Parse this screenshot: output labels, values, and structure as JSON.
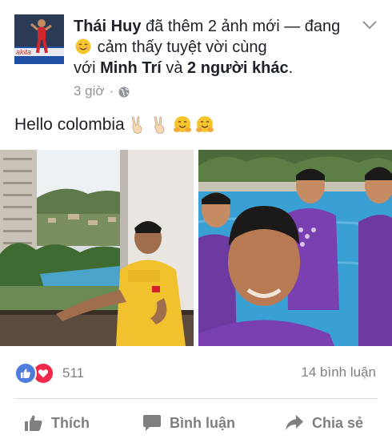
{
  "post": {
    "author": "Thái Huy",
    "action_text": "đã thêm 2 ảnh mới —",
    "feeling_prefix": "đang",
    "feeling_text": "cảm thấy tuyệt vời cùng",
    "with_prefix": "với",
    "tagged_person": "Minh Trí",
    "and_text": "và",
    "others_text": "2 người khác",
    "period": ".",
    "time": "3 giờ",
    "separator": "·",
    "privacy_icon": "globe-icon",
    "message": "Hello colombia",
    "message_emojis": [
      "victory-hand-icon",
      "victory-hand-icon",
      "hugging-face-icon",
      "hugging-face-icon"
    ]
  },
  "photos": [
    {
      "name": "photo-hotel-balcony",
      "description_icon": "photo"
    },
    {
      "name": "photo-pool-selfie",
      "description_icon": "photo"
    }
  ],
  "stats": {
    "reaction_icons": [
      "like-reaction-icon",
      "love-reaction-icon"
    ],
    "reactions_count": "511",
    "comments_count": "14 bình luận"
  },
  "actions": {
    "like_label": "Thích",
    "comment_label": "Bình luận",
    "share_label": "Chia sẻ"
  },
  "colors": {
    "like_blue": "#4f7ddd",
    "love_red": "#f0284a",
    "muted_text": "#7f7f7f",
    "meta_text": "#90949c"
  }
}
